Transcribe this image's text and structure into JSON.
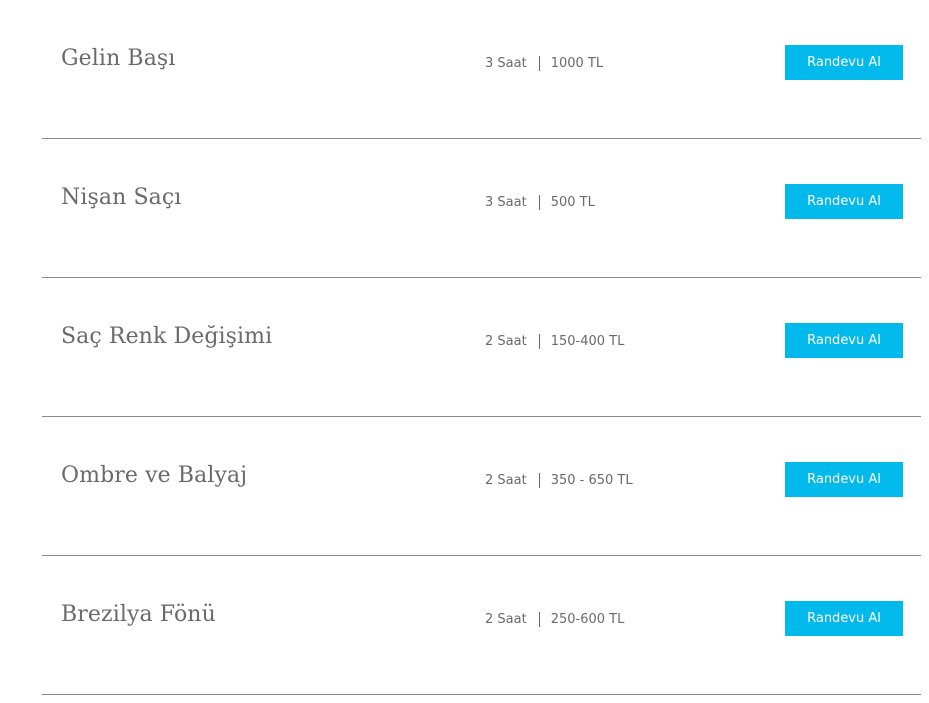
{
  "services": [
    {
      "name": "Gelin Başı",
      "duration": "3 Saat",
      "price": "1000 TL",
      "button_label": "Randevu Al"
    },
    {
      "name": "Nişan Saçı",
      "duration": "3 Saat",
      "price": "500 TL",
      "button_label": "Randevu Al"
    },
    {
      "name": "Saç Renk Değişimi",
      "duration": "2 Saat",
      "price": "150-400 TL",
      "button_label": "Randevu Al"
    },
    {
      "name": "Ombre ve Balyaj",
      "duration": "2 Saat",
      "price": "350 - 650 TL",
      "button_label": "Randevu Al"
    },
    {
      "name": "Brezilya Fönü",
      "duration": "2 Saat",
      "price": "250-600 TL",
      "button_label": "Randevu Al"
    }
  ],
  "colors": {
    "accent": "#02b9ec",
    "text": "#6a6a6a",
    "divider": "#8a8a8a"
  }
}
